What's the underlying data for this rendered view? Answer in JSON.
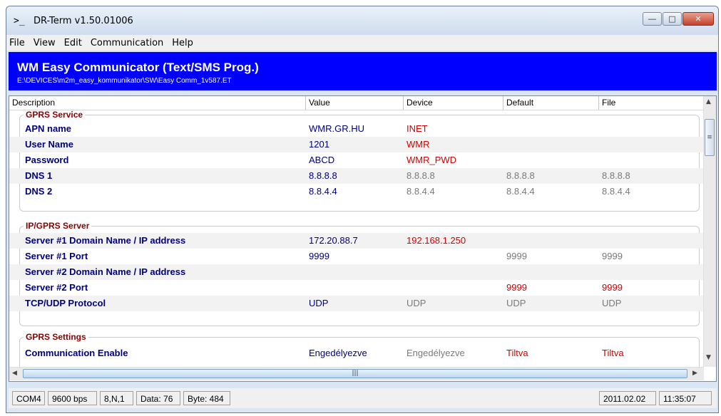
{
  "window": {
    "title": "DR-Term  v1.50.01006",
    "icon": "terminal-prompt-icon",
    "buttons": {
      "minimize": "minimize-icon",
      "maximize": "maximize-icon",
      "close": "close-icon"
    }
  },
  "menu": [
    "File",
    "View",
    "Edit",
    "Communication",
    "Help"
  ],
  "banner": {
    "title": "WM Easy Communicator (Text/SMS Prog.)",
    "path": "E:\\DEVICES\\m2m_easy_kommunikator\\SW\\Easy Comm_1v587.ET",
    "background": "#0000fe"
  },
  "columns": [
    "Description",
    "Value",
    "Device",
    "Default",
    "File"
  ],
  "groups": [
    {
      "label": "GPRS Service",
      "rows": [
        {
          "desc": "APN name",
          "value": "WMR.GR.HU",
          "device": "INET",
          "default": "",
          "file": ""
        },
        {
          "desc": "User Name",
          "value": "1201",
          "device": "WMR",
          "default": "",
          "file": ""
        },
        {
          "desc": "Password",
          "value": "ABCD",
          "device": "WMR_PWD",
          "default": "",
          "file": ""
        },
        {
          "desc": "DNS 1",
          "value": "8.8.8.8",
          "device": "8.8.8.8",
          "default": "8.8.8.8",
          "file": "8.8.8.8"
        },
        {
          "desc": "DNS 2",
          "value": "8.8.4.4",
          "device": "8.8.4.4",
          "default": "8.8.4.4",
          "file": "8.8.4.4"
        }
      ]
    },
    {
      "label": "IP/GPRS Server",
      "rows": [
        {
          "desc": "Server #1 Domain Name / IP address",
          "value": "172.20.88.7",
          "device": "192.168.1.250",
          "default": "",
          "file": ""
        },
        {
          "desc": "Server #1 Port",
          "value": "9999",
          "device": "",
          "default": "9999",
          "file": "9999"
        },
        {
          "desc": "Server #2 Domain Name / IP address",
          "value": "",
          "device": "",
          "default": "",
          "file": ""
        },
        {
          "desc": "Server #2 Port",
          "value": "",
          "device": "",
          "default": "9999",
          "file": "9999"
        },
        {
          "desc": "TCP/UDP Protocol",
          "value": "UDP",
          "device": "UDP",
          "default": "UDP",
          "file": "UDP"
        }
      ]
    },
    {
      "label": "GPRS Settings",
      "rows": [
        {
          "desc": "Communication Enable",
          "value": "Engedélyezve",
          "device": "Engedélyezve",
          "default": "Tiltva",
          "file": "Tiltva"
        }
      ]
    }
  ],
  "status": {
    "port": "COM4",
    "baud": "9600 bps",
    "format": "8,N,1",
    "data": "Data: 76",
    "bytes": "Byte: 484",
    "date": "2011.02.02",
    "time": "11:35:07"
  },
  "colors": {
    "group_label": "#8b0000",
    "desc": "#000080",
    "changed": "#d40000",
    "same": "#7a7a7a"
  }
}
